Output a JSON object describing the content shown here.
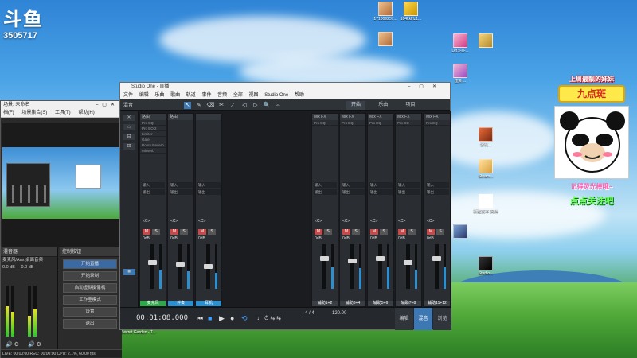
{
  "watermark": {
    "logo": "斗鱼",
    "room_id": "3505717"
  },
  "desktop_icons": [
    {
      "label": "171009257..."
    },
    {
      "label": "184kkHz1..."
    },
    {
      "label": ""
    },
    {
      "label": ""
    },
    {
      "label": "Let's-ill-..."
    },
    {
      "label": ""
    },
    {
      "label": "重新..."
    },
    {
      "label": "录制..."
    },
    {
      "label": "新建..."
    },
    {
      "label": "Steam..."
    },
    {
      "label": "新建文本 文档"
    },
    {
      "label": ""
    },
    {
      "label": "Studio..."
    },
    {
      "label": "Secret Garden - T..."
    }
  ],
  "obs": {
    "title": "场景: 未命名",
    "menu": [
      "档(F)",
      "场景集合(S)",
      "工具(T)",
      "帮助(H)"
    ],
    "mixer_header": "混音器",
    "control_header": "控制按钮",
    "mixer_rows": [
      "麦克风/Aux",
      "桌面音频",
      "0.0 dB",
      "0.0 dB"
    ],
    "buttons": [
      "开始直播",
      "开始录制",
      "启动虚拟摄像机",
      "工作室模式",
      "设置",
      "退出"
    ],
    "status": "LIVE: 00:00:00   REC: 00:00:00   CPU: 2.1%, 60.00 fps"
  },
  "studio_one": {
    "title": "Studio One - 直播",
    "menu": [
      "文件",
      "编辑",
      "乐曲",
      "歌曲",
      "轨道",
      "事件",
      "音频",
      "全部",
      "视图",
      "Studio One",
      "帮助"
    ],
    "song_label": "混音",
    "tools": [
      "↖",
      "✎",
      "⌫",
      "✂",
      "⟋",
      "◁",
      "▷",
      "🔍",
      "⇔"
    ],
    "toolbar_buttons": [
      "开始",
      "乐曲",
      "项目",
      "发布"
    ],
    "sidebar": [
      "✕",
      "⌂",
      "⊟",
      "⊞",
      "■"
    ],
    "strips": [
      {
        "top": "路由",
        "name": "麦克风"
      },
      {
        "top": "路由",
        "name": "伴奏"
      },
      {
        "top": "",
        "name": "耳机"
      },
      {
        "top": "Mix FX",
        "name": "辅助1+2"
      },
      {
        "top": "Mix FX",
        "name": "辅助3+4"
      },
      {
        "top": "Mix FX",
        "name": "辅助5+6"
      },
      {
        "top": "Mix FX",
        "name": "辅助7+8"
      },
      {
        "top": "Mix FX",
        "name": "辅助9+10"
      },
      {
        "top": "Mix FX",
        "name": "辅助11+12"
      }
    ],
    "strip_slots": [
      "Pro EQ",
      "Pro EQ 2",
      "Limiter",
      "Gate",
      "Room Reverb",
      "Mixverb"
    ],
    "strip_io": [
      "输入",
      "输出"
    ],
    "pan_label": "<C>",
    "vol_label": "0dB",
    "time": "00:01:08.000",
    "tempo": "120.00",
    "signature": "4 / 4",
    "right_tabs": [
      "编辑",
      "混音",
      "浏览"
    ]
  },
  "sticker": {
    "top_text": "上周最靓的妹妹",
    "banner": "九点斑",
    "msg1": "记得荧光棒哦~",
    "msg2": "点点关注吧"
  }
}
